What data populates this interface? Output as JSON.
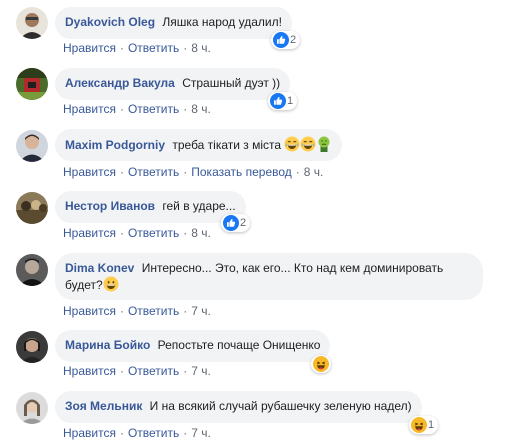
{
  "actions": {
    "like": "Нравится",
    "reply": "Ответить",
    "translate": "Показать перевод"
  },
  "comments": [
    {
      "author": "Dyakovich Oleg",
      "text": "Ляшка народ удалил!",
      "time": "8 ч.",
      "reaction_icon": "like-icon",
      "reaction_count": "2"
    },
    {
      "author": "Александр Вакула",
      "text": "Страшный дуэт ))",
      "time": "8 ч.",
      "reaction_icon": "like-icon",
      "reaction_count": "1"
    },
    {
      "author": "Maxim Podgorniy",
      "text": "треба тікати з міста",
      "time": "8 ч.",
      "emojis": [
        "laughing-emoji",
        "laughing-emoji",
        "nauseated-emoji"
      ]
    },
    {
      "author": "Нестор Иванов",
      "text": "гей в ударе...",
      "time": "8 ч.",
      "reaction_icon": "like-icon",
      "reaction_count": "2"
    },
    {
      "author": "Dima Konev",
      "text_line1": "Интересно... Это, как его... Кто над кем доминировать",
      "text_line2": "будет?",
      "time": "7 ч.",
      "emojis": [
        "grinning-emoji"
      ]
    },
    {
      "author": "Марина Бойко",
      "text": "Репостьте почаще Онищенко",
      "time": "7 ч.",
      "reaction_icon": "haha-icon"
    },
    {
      "author": "Зоя Мельник",
      "text": "И на всякий случай рубашечку зеленую надел)",
      "time": "7 ч.",
      "reaction_icon": "haha-icon",
      "reaction_count": "1"
    }
  ],
  "colors": {
    "link": "#385898",
    "bubble": "#f2f3f5",
    "like_blue": "#1877f2",
    "haha_yellow": "#f7b928"
  }
}
